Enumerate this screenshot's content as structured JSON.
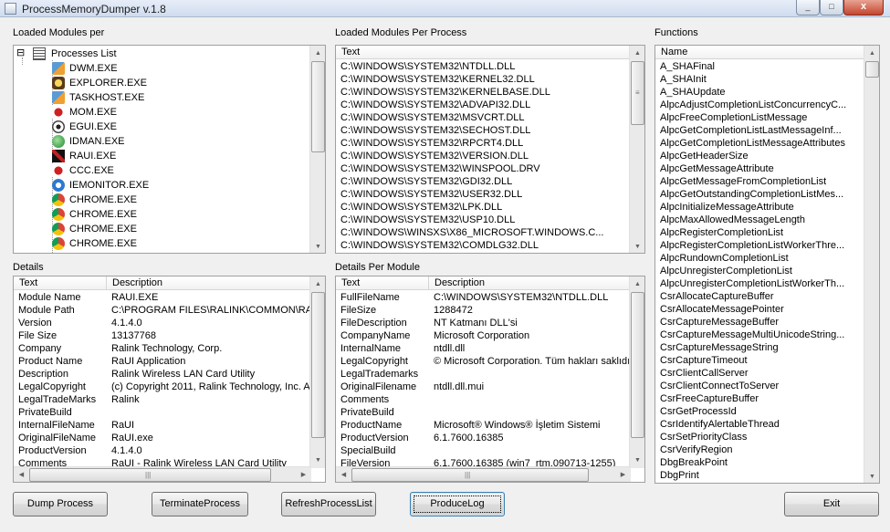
{
  "window": {
    "title": "ProcessMemoryDumper v.1.8",
    "controls": {
      "minimize": "_",
      "maximize": "□",
      "close": "x"
    }
  },
  "labels": {
    "loaded_modules_per": "Loaded Modules per",
    "loaded_modules_per_process": "Loaded Modules Per Process",
    "functions": "Functions",
    "details": "Details",
    "details_per_module": "Details Per Module"
  },
  "process_tree": {
    "root_label": "Processes List",
    "expander": "⊟",
    "processes": [
      {
        "name": "DWM.EXE",
        "icon": "window-app-icon"
      },
      {
        "name": "EXPLORER.EXE",
        "icon": "explorer-icon"
      },
      {
        "name": "TASKHOST.EXE",
        "icon": "window-app-icon"
      },
      {
        "name": "MOM.EXE",
        "icon": "ati-icon"
      },
      {
        "name": "EGUI.EXE",
        "icon": "eset-eye-icon"
      },
      {
        "name": "IDMAN.EXE",
        "icon": "globe-download-icon"
      },
      {
        "name": "RAUI.EXE",
        "icon": "ralink-icon"
      },
      {
        "name": "CCC.EXE",
        "icon": "ati-icon"
      },
      {
        "name": "IEMONITOR.EXE",
        "icon": "ie-icon"
      },
      {
        "name": "CHROME.EXE",
        "icon": "chrome-icon"
      },
      {
        "name": "CHROME.EXE",
        "icon": "chrome-icon"
      },
      {
        "name": "CHROME.EXE",
        "icon": "chrome-icon"
      },
      {
        "name": "CHROME.EXE",
        "icon": "chrome-icon"
      }
    ]
  },
  "modules": {
    "header": "Text",
    "items": [
      "C:\\WINDOWS\\SYSTEM32\\NTDLL.DLL",
      "C:\\WINDOWS\\SYSTEM32\\KERNEL32.DLL",
      "C:\\WINDOWS\\SYSTEM32\\KERNELBASE.DLL",
      "C:\\WINDOWS\\SYSTEM32\\ADVAPI32.DLL",
      "C:\\WINDOWS\\SYSTEM32\\MSVCRT.DLL",
      "C:\\WINDOWS\\SYSTEM32\\SECHOST.DLL",
      "C:\\WINDOWS\\SYSTEM32\\RPCRT4.DLL",
      "C:\\WINDOWS\\SYSTEM32\\VERSION.DLL",
      "C:\\WINDOWS\\SYSTEM32\\WINSPOOL.DRV",
      "C:\\WINDOWS\\SYSTEM32\\GDI32.DLL",
      "C:\\WINDOWS\\SYSTEM32\\USER32.DLL",
      "C:\\WINDOWS\\SYSTEM32\\LPK.DLL",
      "C:\\WINDOWS\\SYSTEM32\\USP10.DLL",
      "C:\\WINDOWS\\WINSXS\\X86_MICROSOFT.WINDOWS.C...",
      "C:\\WINDOWS\\SYSTEM32\\COMDLG32.DLL"
    ]
  },
  "functions": {
    "header": "Name",
    "items": [
      "A_SHAFinal",
      "A_SHAInit",
      "A_SHAUpdate",
      "AlpcAdjustCompletionListConcurrencyC...",
      "AlpcFreeCompletionListMessage",
      "AlpcGetCompletionListLastMessageInf...",
      "AlpcGetCompletionListMessageAttributes",
      "AlpcGetHeaderSize",
      "AlpcGetMessageAttribute",
      "AlpcGetMessageFromCompletionList",
      "AlpcGetOutstandingCompletionListMes...",
      "AlpcInitializeMessageAttribute",
      "AlpcMaxAllowedMessageLength",
      "AlpcRegisterCompletionList",
      "AlpcRegisterCompletionListWorkerThre...",
      "AlpcRundownCompletionList",
      "AlpcUnregisterCompletionList",
      "AlpcUnregisterCompletionListWorkerTh...",
      "CsrAllocateCaptureBuffer",
      "CsrAllocateMessagePointer",
      "CsrCaptureMessageBuffer",
      "CsrCaptureMessageMultiUnicodeString...",
      "CsrCaptureMessageString",
      "CsrCaptureTimeout",
      "CsrClientCallServer",
      "CsrClientConnectToServer",
      "CsrFreeCaptureBuffer",
      "CsrGetProcessId",
      "CsrIdentifyAlertableThread",
      "CsrSetPriorityClass",
      "CsrVerifyRegion",
      "DbgBreakPoint",
      "DbgPrint"
    ]
  },
  "details": {
    "headers": [
      "Text",
      "Description"
    ],
    "rows": [
      [
        "Module Name",
        "RAUI.EXE"
      ],
      [
        "Module Path",
        "C:\\PROGRAM FILES\\RALINK\\COMMON\\RA"
      ],
      [
        "Version",
        "4.1.4.0"
      ],
      [
        "File Size",
        "13137768"
      ],
      [
        "Company",
        "Ralink Technology, Corp."
      ],
      [
        "Product Name",
        "RaUI Application"
      ],
      [
        "Description",
        "Ralink Wireless LAN Card Utility"
      ],
      [
        "LegalCopyright",
        "(c) Copyright 2011, Ralink Technology, Inc.  A"
      ],
      [
        "LegalTradeMarks",
        "Ralink"
      ],
      [
        "PrivateBuild",
        ""
      ],
      [
        "InternalFileName",
        "RaUI"
      ],
      [
        "OriginalFileName",
        "RaUI.exe"
      ],
      [
        "ProductVersion",
        "4.1.4.0"
      ],
      [
        "Comments",
        "RaUI - Ralink Wireless LAN Card Utility"
      ]
    ]
  },
  "module_details": {
    "headers": [
      "Text",
      "Description"
    ],
    "rows": [
      [
        "FullFileName",
        "C:\\WINDOWS\\SYSTEM32\\NTDLL.DLL"
      ],
      [
        "FileSize",
        "1288472"
      ],
      [
        "FileDescription",
        "NT Katmanı DLL'si"
      ],
      [
        "CompanyName",
        "Microsoft Corporation"
      ],
      [
        "InternalName",
        "ntdll.dll"
      ],
      [
        "LegalCopyright",
        "© Microsoft Corporation. Tüm hakları saklıdır."
      ],
      [
        "LegalTrademarks",
        ""
      ],
      [
        "OriginalFilename",
        "ntdll.dll.mui"
      ],
      [
        "Comments",
        ""
      ],
      [
        "PrivateBuild",
        ""
      ],
      [
        "ProductName",
        "Microsoft® Windows® İşletim Sistemi"
      ],
      [
        "ProductVersion",
        "6.1.7600.16385"
      ],
      [
        "SpecialBuild",
        ""
      ],
      [
        "FileVersion",
        "6.1.7600.16385 (win7_rtm.090713-1255)"
      ]
    ]
  },
  "buttons": {
    "dump": "Dump Process",
    "terminate": "TerminateProcess",
    "refresh": "RefreshProcessList",
    "produce_log": "ProduceLog",
    "exit": "Exit"
  },
  "colors": {
    "window_bg": "#f0f0f0",
    "list_bg": "#ffffff",
    "header_bg": "#f7f7f7"
  }
}
